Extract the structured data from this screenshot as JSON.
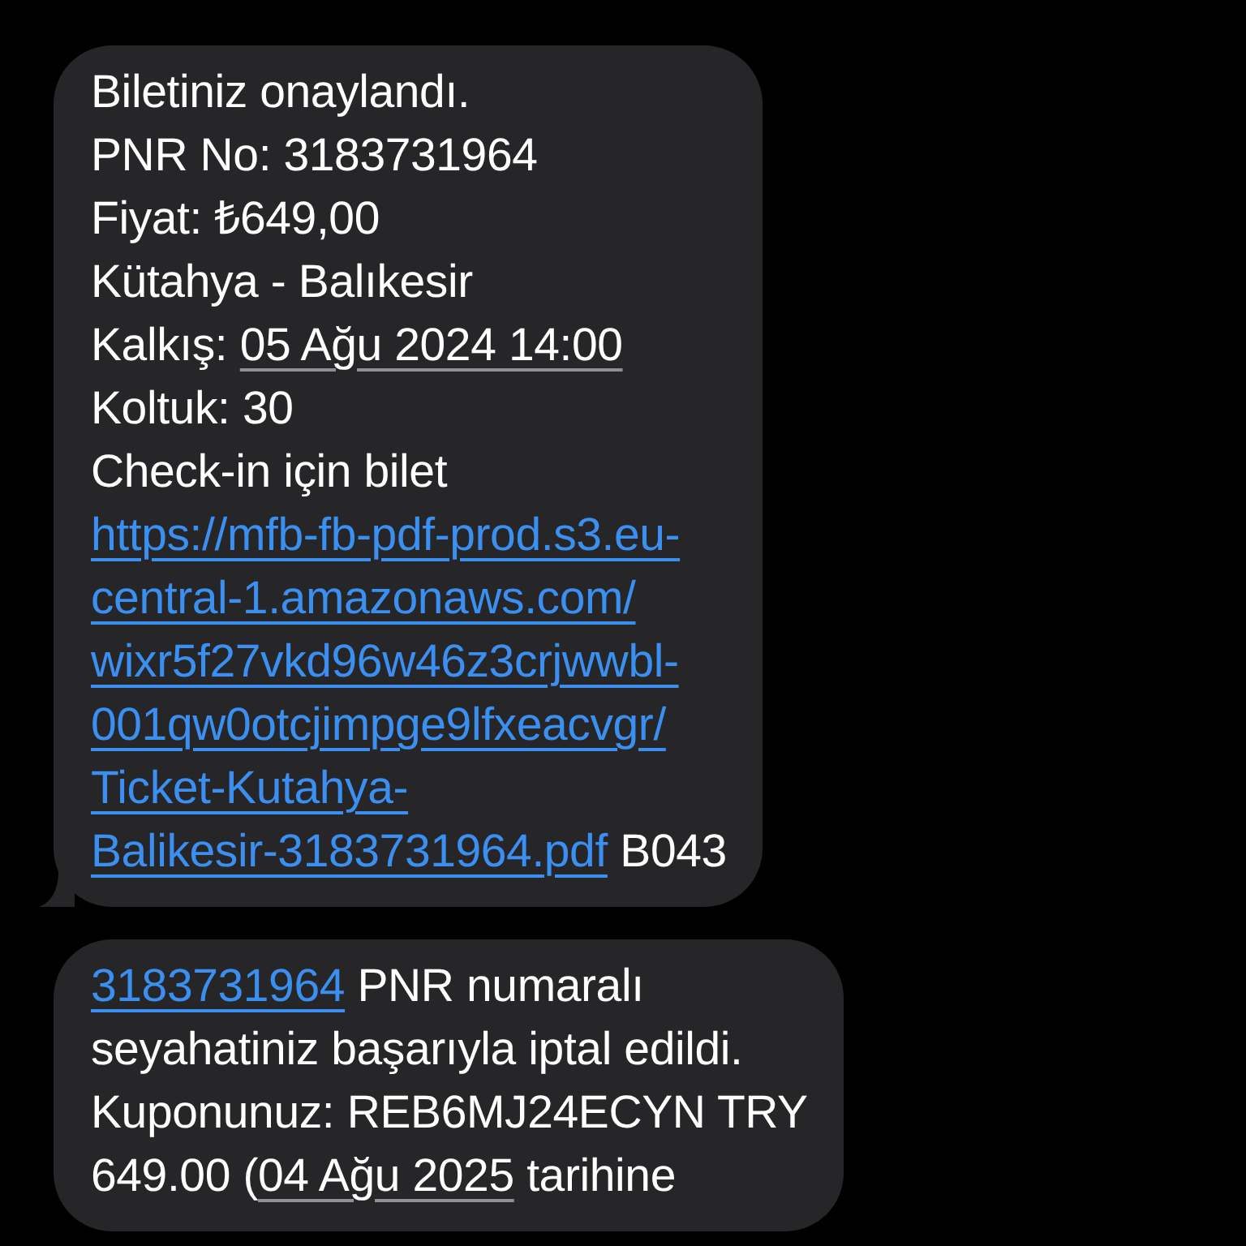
{
  "messages": [
    {
      "tail": true,
      "lines": [
        [
          {
            "kind": "text",
            "text": "Biletiniz onaylandı."
          }
        ],
        [
          {
            "kind": "text",
            "text": "PNR No: 3183731964"
          }
        ],
        [
          {
            "kind": "text",
            "text": "Fiyat: ₺649,00"
          }
        ],
        [
          {
            "kind": "text",
            "text": "Kütahya - Balıkesir"
          }
        ],
        [
          {
            "kind": "text",
            "text": "Kalkış: "
          },
          {
            "kind": "date",
            "text": "05 Ağu 2024 14:00"
          }
        ],
        [
          {
            "kind": "text",
            "text": "Koltuk: 30"
          }
        ],
        [
          {
            "kind": "text",
            "text": "Check-in için bilet"
          }
        ],
        [
          {
            "kind": "link",
            "text": "https://mfb-fb-pdf-prod.s3.eu-"
          }
        ],
        [
          {
            "kind": "link",
            "text": "central-1.amazonaws.com/"
          }
        ],
        [
          {
            "kind": "link",
            "text": "wixr5f27vkd96w46z3crjwwbl-"
          }
        ],
        [
          {
            "kind": "link",
            "text": "001qw0otcjimpge9lfxeacvgr/"
          }
        ],
        [
          {
            "kind": "link",
            "text": "Ticket-Kutahya-"
          }
        ],
        [
          {
            "kind": "link",
            "text": "Balikesir-3183731964.pdf"
          },
          {
            "kind": "text",
            "text": " B043"
          }
        ]
      ]
    },
    {
      "tail": false,
      "lines": [
        [
          {
            "kind": "link",
            "text": "3183731964"
          },
          {
            "kind": "text",
            "text": " PNR numaralı"
          }
        ],
        [
          {
            "kind": "text",
            "text": "seyahatiniz başarıyla iptal edildi."
          }
        ],
        [
          {
            "kind": "text",
            "text": "Kuponunuz: REB6MJ24ECYN TRY"
          }
        ],
        [
          {
            "kind": "text",
            "text": "649.00 ("
          },
          {
            "kind": "date",
            "text": "04 Ağu 2025"
          },
          {
            "kind": "text",
            "text": " tarihine"
          }
        ]
      ]
    }
  ]
}
